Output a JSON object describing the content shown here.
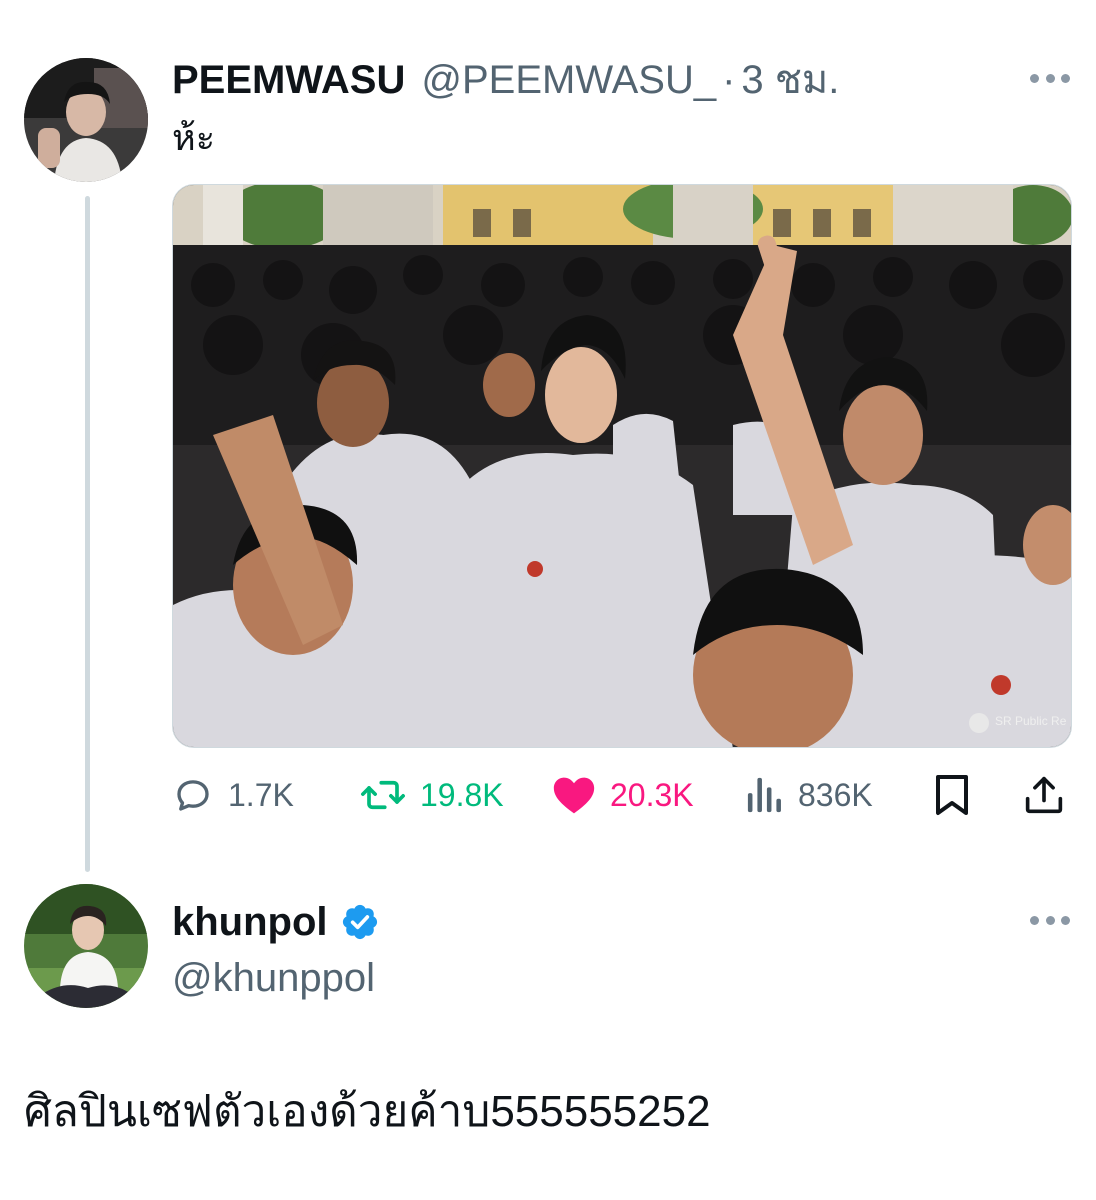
{
  "tweet": {
    "display_name": "PEEMWASU",
    "handle": "@PEEMWASU_",
    "separator": "·",
    "time": "3 ชม.",
    "text": "ห้ะ",
    "actions": {
      "replies": "1.7K",
      "retweets": "19.8K",
      "likes": "20.3K",
      "views": "836K"
    },
    "media_watermark": "SR Public Re"
  },
  "reply": {
    "display_name": "khunpol",
    "verified": true,
    "handle": "@khunppol",
    "text": "ศิลปินเซฟตัวเองด้วยค้าบ555555252"
  },
  "icons": {
    "more": "more-horizontal-icon",
    "reply": "reply-bubble-icon",
    "retweet": "retweet-icon",
    "like": "heart-icon",
    "views": "views-bar-chart-icon",
    "bookmark": "bookmark-icon",
    "share": "share-upload-icon",
    "verified": "verified-badge-icon"
  },
  "colors": {
    "text_primary": "#0f1419",
    "text_secondary": "#536471",
    "retweet_green": "#00ba7c",
    "like_pink": "#f91880",
    "verified_blue": "#1d9bf0",
    "thread_line": "#cfd9de"
  }
}
